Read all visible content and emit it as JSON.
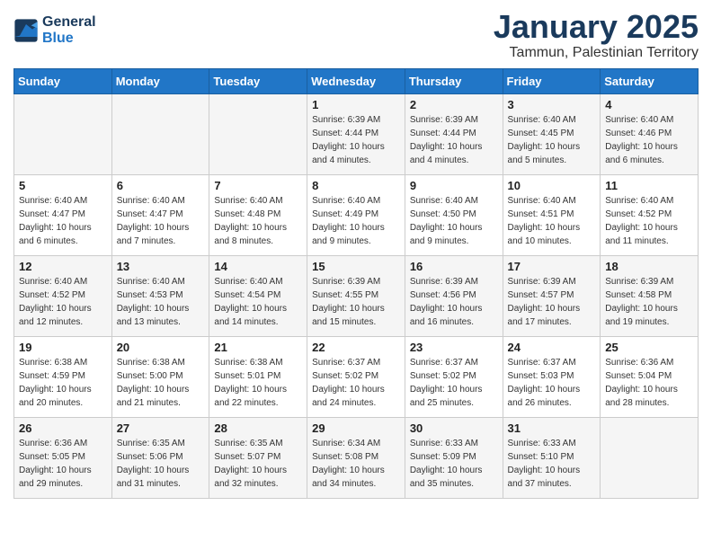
{
  "header": {
    "logo_line1": "General",
    "logo_line2": "Blue",
    "title": "January 2025",
    "subtitle": "Tammun, Palestinian Territory"
  },
  "days_of_week": [
    "Sunday",
    "Monday",
    "Tuesday",
    "Wednesday",
    "Thursday",
    "Friday",
    "Saturday"
  ],
  "weeks": [
    [
      {
        "num": "",
        "sunrise": "",
        "sunset": "",
        "daylight": ""
      },
      {
        "num": "",
        "sunrise": "",
        "sunset": "",
        "daylight": ""
      },
      {
        "num": "",
        "sunrise": "",
        "sunset": "",
        "daylight": ""
      },
      {
        "num": "1",
        "sunrise": "Sunrise: 6:39 AM",
        "sunset": "Sunset: 4:44 PM",
        "daylight": "Daylight: 10 hours and 4 minutes."
      },
      {
        "num": "2",
        "sunrise": "Sunrise: 6:39 AM",
        "sunset": "Sunset: 4:44 PM",
        "daylight": "Daylight: 10 hours and 4 minutes."
      },
      {
        "num": "3",
        "sunrise": "Sunrise: 6:40 AM",
        "sunset": "Sunset: 4:45 PM",
        "daylight": "Daylight: 10 hours and 5 minutes."
      },
      {
        "num": "4",
        "sunrise": "Sunrise: 6:40 AM",
        "sunset": "Sunset: 4:46 PM",
        "daylight": "Daylight: 10 hours and 6 minutes."
      }
    ],
    [
      {
        "num": "5",
        "sunrise": "Sunrise: 6:40 AM",
        "sunset": "Sunset: 4:47 PM",
        "daylight": "Daylight: 10 hours and 6 minutes."
      },
      {
        "num": "6",
        "sunrise": "Sunrise: 6:40 AM",
        "sunset": "Sunset: 4:47 PM",
        "daylight": "Daylight: 10 hours and 7 minutes."
      },
      {
        "num": "7",
        "sunrise": "Sunrise: 6:40 AM",
        "sunset": "Sunset: 4:48 PM",
        "daylight": "Daylight: 10 hours and 8 minutes."
      },
      {
        "num": "8",
        "sunrise": "Sunrise: 6:40 AM",
        "sunset": "Sunset: 4:49 PM",
        "daylight": "Daylight: 10 hours and 9 minutes."
      },
      {
        "num": "9",
        "sunrise": "Sunrise: 6:40 AM",
        "sunset": "Sunset: 4:50 PM",
        "daylight": "Daylight: 10 hours and 9 minutes."
      },
      {
        "num": "10",
        "sunrise": "Sunrise: 6:40 AM",
        "sunset": "Sunset: 4:51 PM",
        "daylight": "Daylight: 10 hours and 10 minutes."
      },
      {
        "num": "11",
        "sunrise": "Sunrise: 6:40 AM",
        "sunset": "Sunset: 4:52 PM",
        "daylight": "Daylight: 10 hours and 11 minutes."
      }
    ],
    [
      {
        "num": "12",
        "sunrise": "Sunrise: 6:40 AM",
        "sunset": "Sunset: 4:52 PM",
        "daylight": "Daylight: 10 hours and 12 minutes."
      },
      {
        "num": "13",
        "sunrise": "Sunrise: 6:40 AM",
        "sunset": "Sunset: 4:53 PM",
        "daylight": "Daylight: 10 hours and 13 minutes."
      },
      {
        "num": "14",
        "sunrise": "Sunrise: 6:40 AM",
        "sunset": "Sunset: 4:54 PM",
        "daylight": "Daylight: 10 hours and 14 minutes."
      },
      {
        "num": "15",
        "sunrise": "Sunrise: 6:39 AM",
        "sunset": "Sunset: 4:55 PM",
        "daylight": "Daylight: 10 hours and 15 minutes."
      },
      {
        "num": "16",
        "sunrise": "Sunrise: 6:39 AM",
        "sunset": "Sunset: 4:56 PM",
        "daylight": "Daylight: 10 hours and 16 minutes."
      },
      {
        "num": "17",
        "sunrise": "Sunrise: 6:39 AM",
        "sunset": "Sunset: 4:57 PM",
        "daylight": "Daylight: 10 hours and 17 minutes."
      },
      {
        "num": "18",
        "sunrise": "Sunrise: 6:39 AM",
        "sunset": "Sunset: 4:58 PM",
        "daylight": "Daylight: 10 hours and 19 minutes."
      }
    ],
    [
      {
        "num": "19",
        "sunrise": "Sunrise: 6:38 AM",
        "sunset": "Sunset: 4:59 PM",
        "daylight": "Daylight: 10 hours and 20 minutes."
      },
      {
        "num": "20",
        "sunrise": "Sunrise: 6:38 AM",
        "sunset": "Sunset: 5:00 PM",
        "daylight": "Daylight: 10 hours and 21 minutes."
      },
      {
        "num": "21",
        "sunrise": "Sunrise: 6:38 AM",
        "sunset": "Sunset: 5:01 PM",
        "daylight": "Daylight: 10 hours and 22 minutes."
      },
      {
        "num": "22",
        "sunrise": "Sunrise: 6:37 AM",
        "sunset": "Sunset: 5:02 PM",
        "daylight": "Daylight: 10 hours and 24 minutes."
      },
      {
        "num": "23",
        "sunrise": "Sunrise: 6:37 AM",
        "sunset": "Sunset: 5:02 PM",
        "daylight": "Daylight: 10 hours and 25 minutes."
      },
      {
        "num": "24",
        "sunrise": "Sunrise: 6:37 AM",
        "sunset": "Sunset: 5:03 PM",
        "daylight": "Daylight: 10 hours and 26 minutes."
      },
      {
        "num": "25",
        "sunrise": "Sunrise: 6:36 AM",
        "sunset": "Sunset: 5:04 PM",
        "daylight": "Daylight: 10 hours and 28 minutes."
      }
    ],
    [
      {
        "num": "26",
        "sunrise": "Sunrise: 6:36 AM",
        "sunset": "Sunset: 5:05 PM",
        "daylight": "Daylight: 10 hours and 29 minutes."
      },
      {
        "num": "27",
        "sunrise": "Sunrise: 6:35 AM",
        "sunset": "Sunset: 5:06 PM",
        "daylight": "Daylight: 10 hours and 31 minutes."
      },
      {
        "num": "28",
        "sunrise": "Sunrise: 6:35 AM",
        "sunset": "Sunset: 5:07 PM",
        "daylight": "Daylight: 10 hours and 32 minutes."
      },
      {
        "num": "29",
        "sunrise": "Sunrise: 6:34 AM",
        "sunset": "Sunset: 5:08 PM",
        "daylight": "Daylight: 10 hours and 34 minutes."
      },
      {
        "num": "30",
        "sunrise": "Sunrise: 6:33 AM",
        "sunset": "Sunset: 5:09 PM",
        "daylight": "Daylight: 10 hours and 35 minutes."
      },
      {
        "num": "31",
        "sunrise": "Sunrise: 6:33 AM",
        "sunset": "Sunset: 5:10 PM",
        "daylight": "Daylight: 10 hours and 37 minutes."
      },
      {
        "num": "",
        "sunrise": "",
        "sunset": "",
        "daylight": ""
      }
    ]
  ]
}
